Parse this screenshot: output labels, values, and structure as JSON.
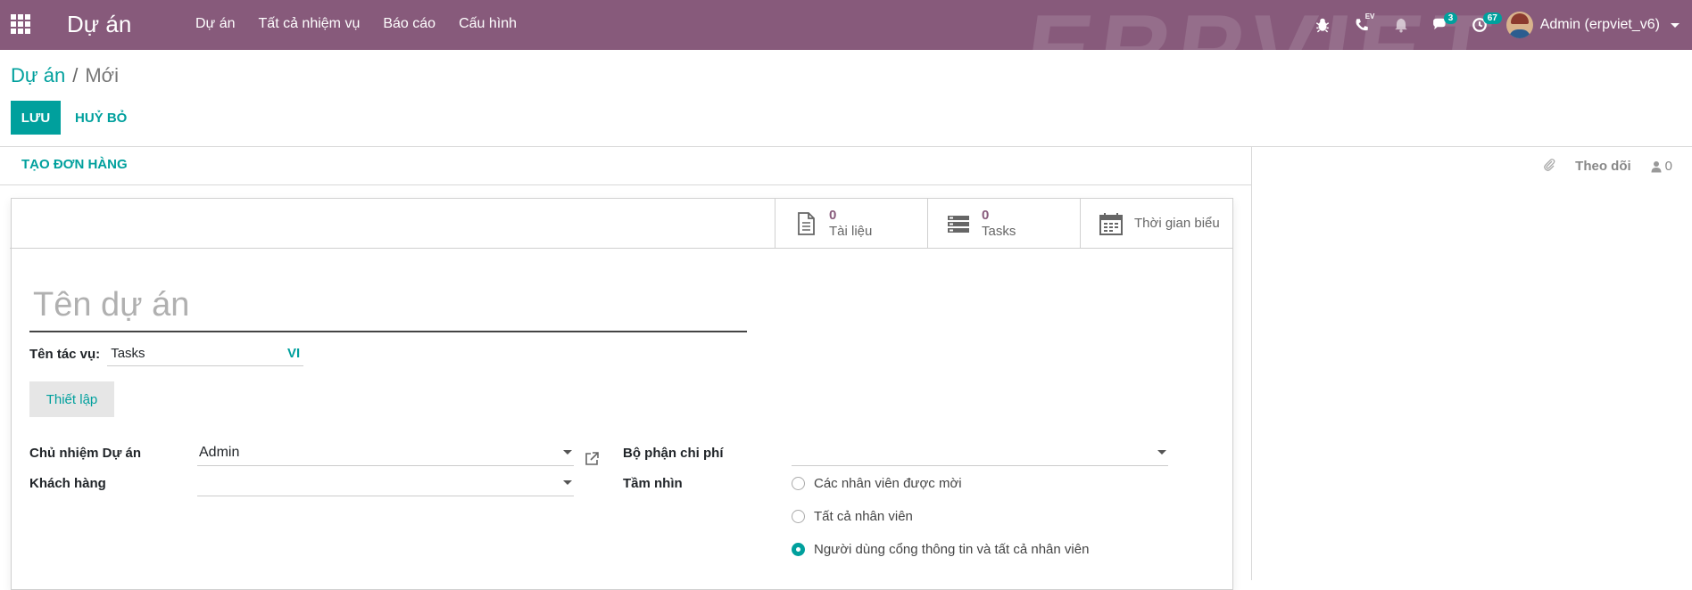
{
  "navbar": {
    "app_title": "Dự án",
    "menu": [
      "Dự án",
      "Tất cả nhiệm vụ",
      "Báo cáo",
      "Cấu hình"
    ],
    "watermark": "ERPVIET",
    "messages_badge": "3",
    "activities_badge": "67",
    "lang_badge": "EV",
    "user_name": "Admin (erpviet_v6)"
  },
  "breadcrumb": {
    "parent": "Dự án",
    "separator": "/",
    "current": "Mới"
  },
  "buttons": {
    "save": "LƯU",
    "discard": "HUỶ BỎ",
    "create_order": "TẠO ĐƠN HÀNG",
    "setup": "Thiết lập"
  },
  "chatter": {
    "follow": "Theo dõi",
    "followers_count": "0"
  },
  "smart_buttons": [
    {
      "value": "0",
      "label": "Tài liệu"
    },
    {
      "value": "0",
      "label": "Tasks"
    },
    {
      "label": "Thời gian biểu"
    }
  ],
  "form": {
    "name_placeholder": "Tên dự án",
    "task_label": "Tên tác vụ:",
    "task_value": "Tasks",
    "task_lang": "VI",
    "manager_label": "Chủ nhiệm Dự án",
    "manager_value": "Admin",
    "customer_label": "Khách hàng",
    "customer_value": "",
    "cost_center_label": "Bộ phận chi phí",
    "cost_center_value": "",
    "visibility_label": "Tầm nhìn",
    "visibility_options": [
      {
        "label": "Các nhân viên được mời",
        "checked": false
      },
      {
        "label": "Tất cả nhân viên",
        "checked": false
      },
      {
        "label": "Người dùng cổng thông tin và tất cả nhân viên",
        "checked": true
      }
    ]
  },
  "colors": {
    "navbar": "#875a7b",
    "accent": "#00a09d"
  }
}
